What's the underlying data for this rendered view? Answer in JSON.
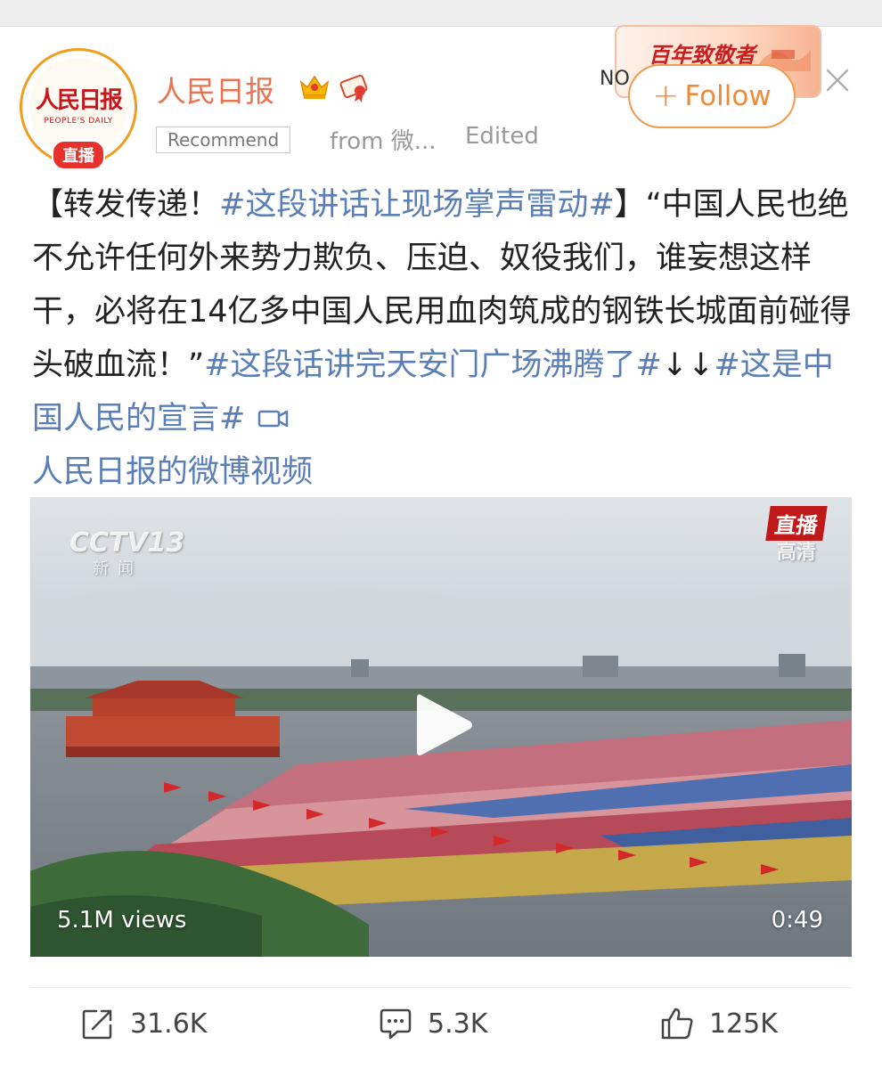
{
  "header": {
    "username": "人民日报",
    "avatar_title": "人民日报",
    "avatar_subtitle": "PEOPLE'S DAILY",
    "live_badge": "直播",
    "recommend_label": "Recommend",
    "from_text": "from 微...",
    "edited_text": "Edited",
    "follow_label": "Follow",
    "campaign_text": "百年致敬者",
    "campaign_partial_text": "NO",
    "accent_color": "#eb7350"
  },
  "post": {
    "prefix": "【转发传递！",
    "hashtag1": "#这段讲话让现场掌声雷动#",
    "body": "】“中国人民也绝不允许任何外来势力欺负、压迫、奴役我们，谁妄想这样干，必将在14亿多中国人民用血肉筑成的钢铁长城面前碰得头破血流！”",
    "hashtag2": "#这段话讲完天安门广场沸腾了#",
    "arrows": "↓↓",
    "hashtag3": "#这是中国人民的宣言#",
    "video_link": "人民日报的微博视频",
    "hashtag_color": "#5a7fb8"
  },
  "video": {
    "channel_logo": "CCTV13",
    "channel_sub": "新闻",
    "live_tag": "直播",
    "hd_tag": "高清",
    "views": "5.1M views",
    "duration": "0:49"
  },
  "actions": {
    "repost_count": "31.6K",
    "comment_count": "5.3K",
    "like_count": "125K"
  }
}
